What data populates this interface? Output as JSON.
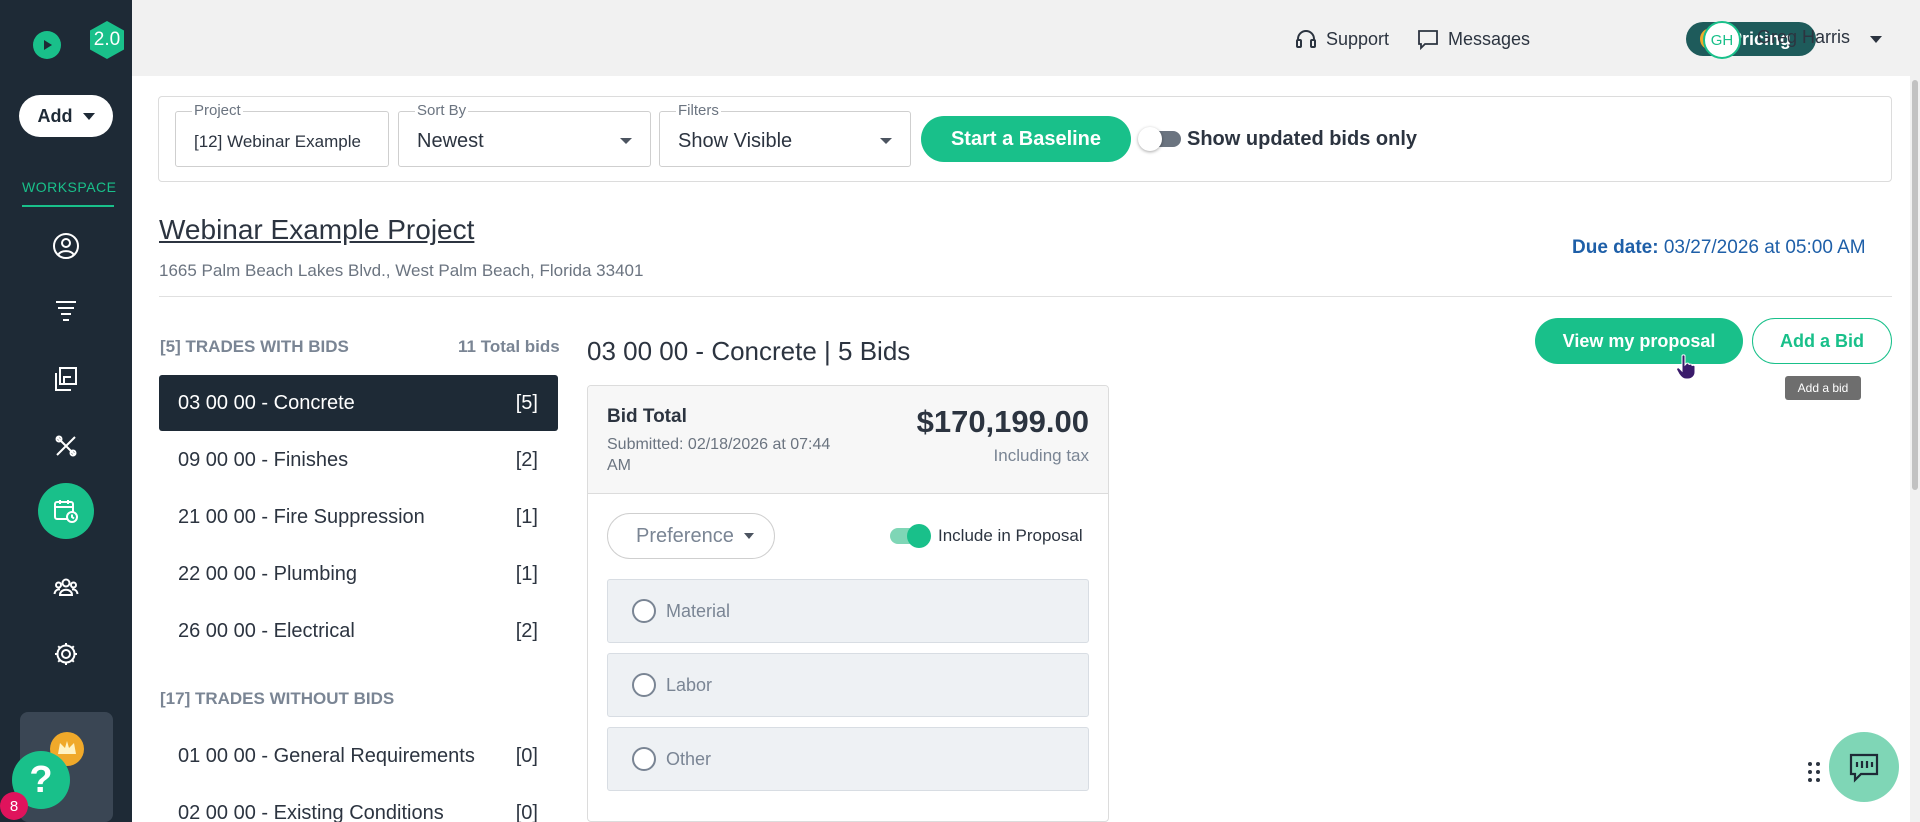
{
  "sidebar": {
    "version_badge": "2.0",
    "add_label": "Add",
    "workspace_label": "WORKSPACE",
    "nav_icons": [
      "user-circle-icon",
      "funnel-icon",
      "documents-icon",
      "tools-icon",
      "calendar-clock-icon",
      "team-icon",
      "settings-icon"
    ],
    "notifications_count": "8",
    "help_label": "?",
    "accent_color": "#19c08a",
    "bg_color": "#1e2a36"
  },
  "topbar": {
    "support_label": "Support",
    "messages_label": "Messages",
    "pricing_label": "Pricing",
    "avatar_initials": "GH",
    "user_name": "Greg Harris"
  },
  "filters": {
    "project_label": "Project",
    "project_value": "[12] Webinar Example",
    "sort_label": "Sort By",
    "sort_value": "Newest",
    "filters_label": "Filters",
    "filters_value": "Show Visible",
    "baseline_label": "Start a Baseline",
    "updated_only_label": "Show updated bids only",
    "updated_only_on": false
  },
  "project": {
    "title": "Webinar Example Project ",
    "address": "1665 Palm Beach Lakes Blvd., West Palm Beach, Florida 33401",
    "due_label": "Due date:",
    "due_value": "03/27/2026 at 05:00 AM"
  },
  "trades_with_bids": {
    "heading": "[5] TRADES WITH BIDS",
    "total_label": "11 Total bids",
    "items": [
      {
        "name": "03 00 00 - Concrete",
        "count": "[5]",
        "active": true
      },
      {
        "name": "09 00 00 - Finishes",
        "count": "[2]"
      },
      {
        "name": "21 00 00 - Fire Suppression",
        "count": "[1]"
      },
      {
        "name": "22 00 00 - Plumbing",
        "count": "[1]"
      },
      {
        "name": "26 00 00 - Electrical",
        "count": "[2]"
      }
    ]
  },
  "trades_without_bids": {
    "heading": "[17] TRADES WITHOUT BIDS",
    "items": [
      {
        "name": "01 00 00 - General Requirements",
        "count": "[0]"
      },
      {
        "name": "02 00 00 - Existing Conditions",
        "count": "[0]"
      }
    ]
  },
  "bids": {
    "title": "03 00 00 - Concrete | 5 Bids",
    "view_proposal_label": "View my proposal",
    "add_bid_label": "Add a Bid",
    "add_bid_tooltip": "Add a bid",
    "card": {
      "total_label": "Bid Total",
      "submitted": "Submitted: 02/18/2026 at 07:44 AM",
      "amount": "$170,199.00",
      "tax_note": "Including tax",
      "preference_label": "Preference",
      "include_label": "Include in Proposal",
      "include_on": true,
      "options": [
        "Material",
        "Labor",
        "Other"
      ]
    }
  }
}
